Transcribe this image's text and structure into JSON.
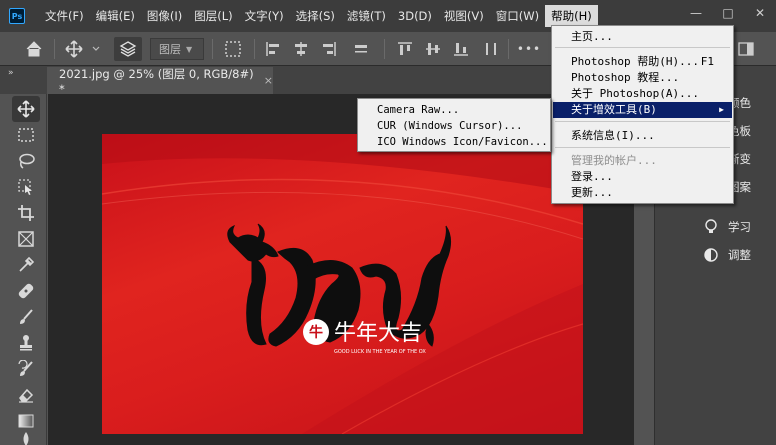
{
  "app": {
    "logo": "Ps"
  },
  "menubar": {
    "items": [
      "文件(F)",
      "编辑(E)",
      "图像(I)",
      "图层(L)",
      "文字(Y)",
      "选择(S)",
      "滤镜(T)",
      "3D(D)",
      "视图(V)",
      "窗口(W)",
      "帮助(H)"
    ],
    "active": "帮助(H)"
  },
  "window_controls": {
    "minimize": "—",
    "maximize": "□",
    "close": "✕"
  },
  "options_bar": {
    "layer_select": "图层",
    "more": "•••"
  },
  "document": {
    "tab_title": "2021.jpg @ 25% (图层 0, RGB/8#) *",
    "close": "×"
  },
  "artwork": {
    "chinese_text": "牛年大吉",
    "english_text": "GOOD LUCK IN THE YEAR OF THE OX",
    "seal_char": "牛",
    "year_glyphs": "2021"
  },
  "right_panel": {
    "items": [
      {
        "label": "颜色",
        "icon": "color-icon"
      },
      {
        "label": "色板",
        "icon": "swatches-icon"
      },
      {
        "label": "渐变",
        "icon": "gradient-icon"
      },
      {
        "label": "图案",
        "icon": "patterns-icon"
      },
      {
        "label": "学习",
        "icon": "bulb-icon"
      },
      {
        "label": "调整",
        "icon": "adjust-icon"
      }
    ]
  },
  "help_menu": {
    "items": [
      {
        "label": "主页...",
        "shortcut": ""
      },
      {
        "label": "Photoshop 帮助(H)...",
        "shortcut": "F1"
      },
      {
        "label": "Photoshop 教程...",
        "shortcut": ""
      },
      {
        "label": "关于 Photoshop(A)...",
        "shortcut": ""
      },
      {
        "label": "关于增效工具(B)",
        "shortcut": "",
        "submenu": true
      },
      {
        "label": "系统信息(I)...",
        "shortcut": ""
      },
      {
        "label": "管理我的帐户...",
        "shortcut": "",
        "disabled": true
      },
      {
        "label": "登录...",
        "shortcut": ""
      },
      {
        "label": "更新...",
        "shortcut": ""
      }
    ]
  },
  "plugins_submenu": {
    "items": [
      "Camera Raw...",
      "CUR (Windows Cursor)...",
      "ICO Windows Icon/Favicon..."
    ]
  },
  "colors": {
    "accent": "#31a8ff",
    "menu_highlight": "#0a2069",
    "artboard_red": "#d91d1d"
  }
}
